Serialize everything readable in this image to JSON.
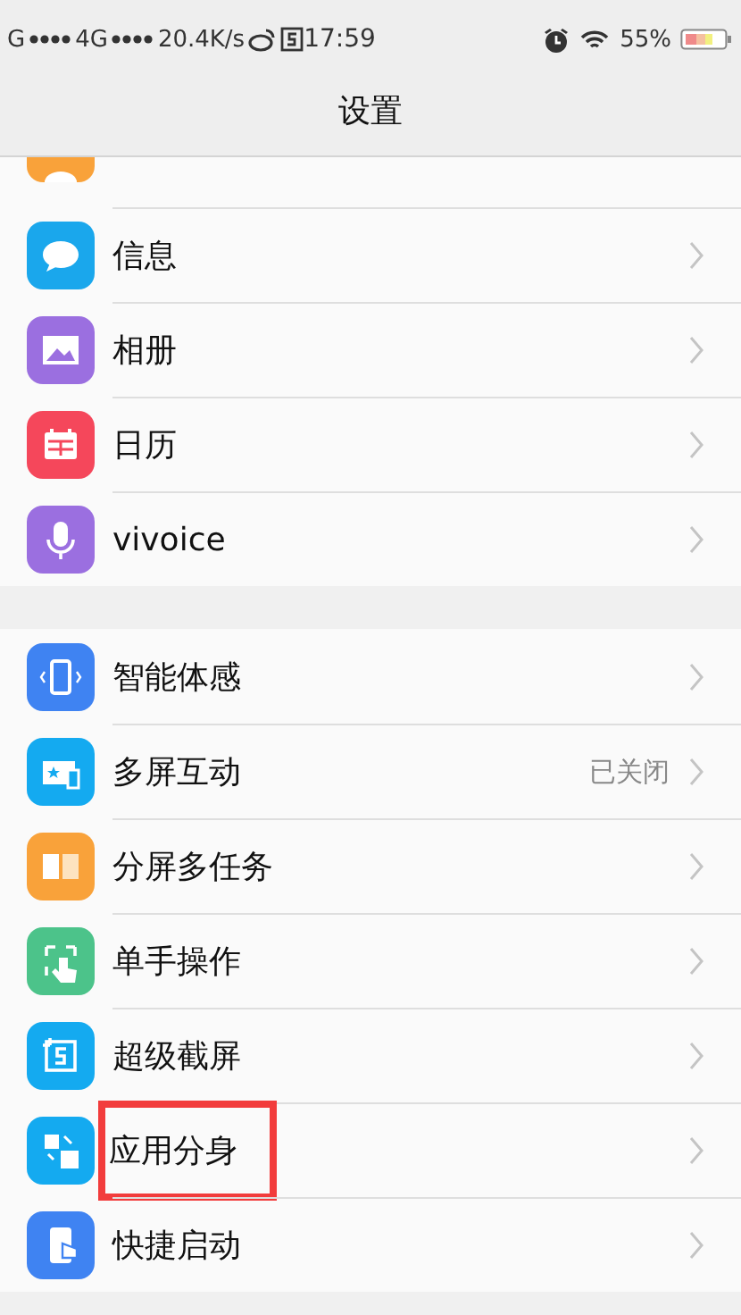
{
  "status_bar": {
    "carrier_1": "G",
    "carrier_2": "4G",
    "speed": "20.4K/s",
    "time": "17:59",
    "battery": "55%"
  },
  "title": "设置",
  "groups": [
    {
      "items": [
        {
          "kind": "contact",
          "color": "#f9a23a"
        },
        {
          "kind": "message",
          "color": "#1aa7ec",
          "label": "信息",
          "highlighted": false
        },
        {
          "kind": "photo",
          "color": "#9b6fe0",
          "label": "相册",
          "highlighted": false
        },
        {
          "kind": "calendar",
          "color": "#f5475b",
          "label": "日历",
          "highlighted": false
        },
        {
          "kind": "mic",
          "color": "#9b6fe0",
          "label": "vivoice",
          "highlighted": false
        }
      ]
    },
    {
      "items": [
        {
          "kind": "motion",
          "color": "#3f83f2",
          "label": "智能体感",
          "highlighted": false
        },
        {
          "kind": "cast",
          "color": "#14aaf0",
          "label": "多屏互动",
          "value": "已关闭",
          "highlighted": false
        },
        {
          "kind": "split",
          "color": "#f9a23a",
          "label": "分屏多任务",
          "highlighted": false
        },
        {
          "kind": "hand",
          "color": "#4cc38a",
          "label": "单手操作",
          "highlighted": false
        },
        {
          "kind": "screenshot",
          "color": "#14aaf0",
          "label": "超级截屏",
          "highlighted": false
        },
        {
          "kind": "clone",
          "color": "#14aaf0",
          "label": "应用分身",
          "highlighted": true
        },
        {
          "kind": "launch",
          "color": "#3f83f2",
          "label": "快捷启动",
          "highlighted": false
        }
      ]
    }
  ]
}
